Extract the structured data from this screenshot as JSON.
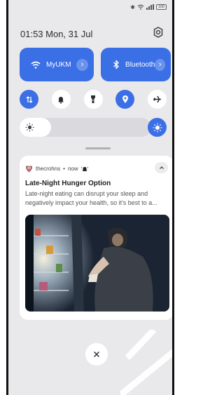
{
  "status_bar": {
    "icons": [
      "bluetooth-icon",
      "wifi-icon",
      "signal-icon",
      "battery-icon"
    ],
    "battery_label": "100"
  },
  "header": {
    "datetime": "01:53  Mon, 31 Jul",
    "settings_icon": "gear-icon"
  },
  "tiles": {
    "wifi": {
      "label": "MyUKM",
      "icon": "wifi-icon"
    },
    "bluetooth": {
      "label": "Bluetooth",
      "icon": "bluetooth-icon"
    }
  },
  "quick_toggles": [
    {
      "name": "mobile-data",
      "icon": "data-arrows-icon",
      "active": true
    },
    {
      "name": "notifications",
      "icon": "bell-icon",
      "active": false
    },
    {
      "name": "flashlight",
      "icon": "flashlight-icon",
      "active": false
    },
    {
      "name": "location",
      "icon": "location-icon",
      "active": true
    },
    {
      "name": "airplane-mode",
      "icon": "airplane-icon",
      "active": false
    }
  ],
  "brightness": {
    "level": 0.24,
    "icon": "sun-icon"
  },
  "notification": {
    "app": "thecrohns",
    "separator": "•",
    "time": "now",
    "title": "Late-Night Hunger Option",
    "text": "Late-night eating can disrupt your sleep and negatively impact your health, so it's best to a..."
  },
  "colors": {
    "accent": "#3a6fe6",
    "panel_background": "#e9e9eb",
    "card_background": "#ffffff"
  }
}
